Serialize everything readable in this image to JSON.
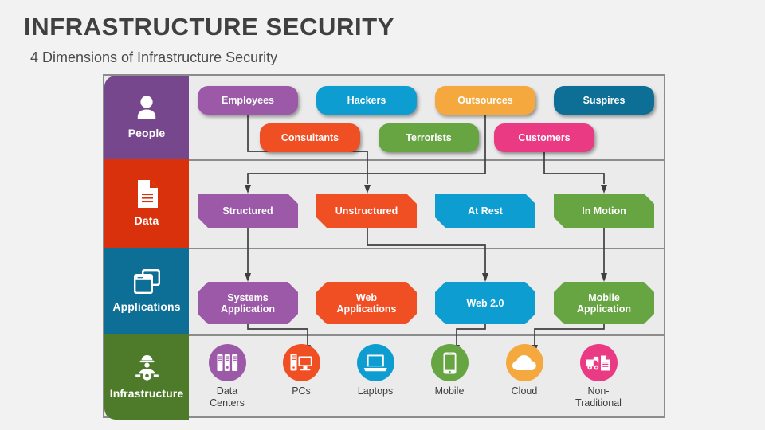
{
  "header": {
    "title": "INFRASTRUCTURE SECURITY",
    "subtitle": "4 Dimensions of Infrastructure Security"
  },
  "palette": {
    "purple": "#9B59A8",
    "purple_dark": "#76478C",
    "blue": "#0D9DD1",
    "blue_dark": "#0F6F96",
    "orange": "#F4A83D",
    "teal_dark": "#0D6F96",
    "red": "#F04E23",
    "red_dark": "#D8310B",
    "green": "#67A543",
    "green_dark": "#4E7B2A",
    "pink": "#EB3A84",
    "gray_bg": "#EBEBEB",
    "frame_border": "#8C8C8C",
    "wire": "#3F3F3F",
    "text_dark": "#3D3D3D"
  },
  "rows": [
    {
      "key": "people",
      "label": "People",
      "icon": "person-icon",
      "color": "#76478C",
      "nodes": [
        {
          "label": "Employees",
          "color": "#9B59A8"
        },
        {
          "label": "Hackers",
          "color": "#0D9DD1"
        },
        {
          "label": "Outsources",
          "color": "#F4A83D"
        },
        {
          "label": "Suspires",
          "color": "#0D6F96"
        },
        {
          "label": "Consultants",
          "color": "#F04E23"
        },
        {
          "label": "Terrorists",
          "color": "#67A543"
        },
        {
          "label": "Customers",
          "color": "#EB3A84"
        }
      ]
    },
    {
      "key": "data",
      "label": "Data",
      "icon": "document-icon",
      "color": "#D8310B",
      "nodes": [
        {
          "label": "Structured",
          "color": "#9B59A8"
        },
        {
          "label": "Unstructured",
          "color": "#F04E23"
        },
        {
          "label": "At Rest",
          "color": "#0D9DD1"
        },
        {
          "label": "In Motion",
          "color": "#67A543"
        }
      ]
    },
    {
      "key": "applications",
      "label": "Applications",
      "icon": "windows-stack-icon",
      "color": "#0D6F96",
      "nodes": [
        {
          "label": "Systems\nApplication",
          "color": "#9B59A8"
        },
        {
          "label": "Web\nApplications",
          "color": "#F04E23"
        },
        {
          "label": "Web 2.0",
          "color": "#0D9DD1"
        },
        {
          "label": "Mobile\nApplication",
          "color": "#67A543"
        }
      ]
    },
    {
      "key": "infrastructure",
      "label": "Infrastructure",
      "icon": "worker-gear-icon",
      "color": "#4E7B2A",
      "nodes": [
        {
          "label": "Data\nCenters",
          "color": "#9B59A8",
          "icon": "servers-icon"
        },
        {
          "label": "PCs",
          "color": "#F04E23",
          "icon": "desktop-pc-icon"
        },
        {
          "label": "Laptops",
          "color": "#0D9DD1",
          "icon": "laptop-icon"
        },
        {
          "label": "Mobile",
          "color": "#67A543",
          "icon": "smartphone-icon"
        },
        {
          "label": "Cloud",
          "color": "#F4A83D",
          "icon": "cloud-icon"
        },
        {
          "label": "Non-\nTraditional",
          "color": "#EB3A84",
          "icon": "truck-document-icon"
        }
      ]
    }
  ]
}
